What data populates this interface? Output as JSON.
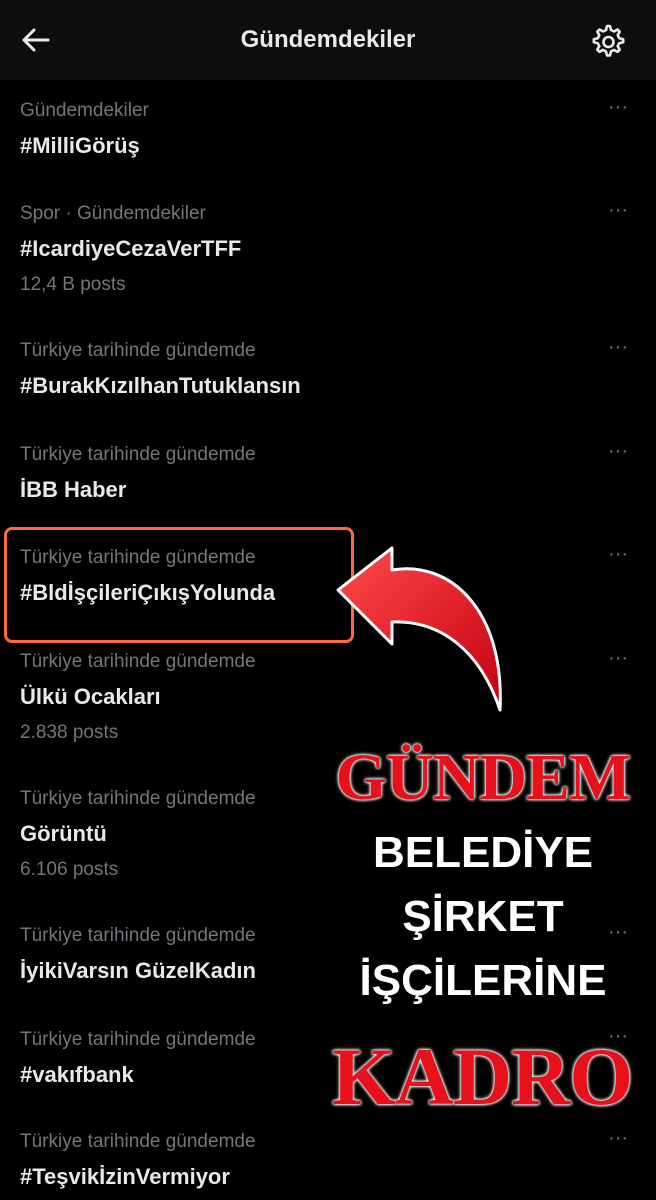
{
  "header": {
    "title": "Gündemdekiler",
    "back_icon": "arrow-left-icon",
    "settings_icon": "gear-icon"
  },
  "trends": [
    {
      "category": "Gündemdekiler",
      "name": "#MilliGörüş",
      "posts": ""
    },
    {
      "category": "Spor · Gündemdekiler",
      "name": "#IcardiyeCezaVerTFF",
      "posts": "12,4 B posts"
    },
    {
      "category": "Türkiye tarihinde gündemde",
      "name": "#BurakKızılhanTutuklansın",
      "posts": ""
    },
    {
      "category": "Türkiye tarihinde gündemde",
      "name": "İBB Haber",
      "posts": ""
    },
    {
      "category": "Türkiye tarihinde gündemde",
      "name": "#BldİşçileriÇıkışYolunda",
      "posts": ""
    },
    {
      "category": "Türkiye tarihinde gündemde",
      "name": "Ülkü Ocakları",
      "posts": "2.838 posts"
    },
    {
      "category": "Türkiye tarihinde gündemde",
      "name": "Görüntü",
      "posts": "6.106 posts"
    },
    {
      "category": "Türkiye tarihinde gündemde",
      "name": "İyikiVarsın GüzelKadın",
      "posts": ""
    },
    {
      "category": "Türkiye tarihinde gündemde",
      "name": "#vakıfbank",
      "posts": ""
    },
    {
      "category": "Türkiye tarihinde gündemde",
      "name": "#TeşvikİzinVermiyor",
      "posts": ""
    }
  ],
  "more_label": "···",
  "overlay": {
    "line1": "GÜNDEM",
    "line2": "BELEDİYE",
    "line3": "ŞİRKET",
    "line4": "İŞÇİLERİNE",
    "line5": "KADRO"
  },
  "colors": {
    "background": "#000000",
    "accent_red": "#e8101a",
    "highlight_border": "#ff6a3d",
    "muted_text": "#71767b"
  }
}
